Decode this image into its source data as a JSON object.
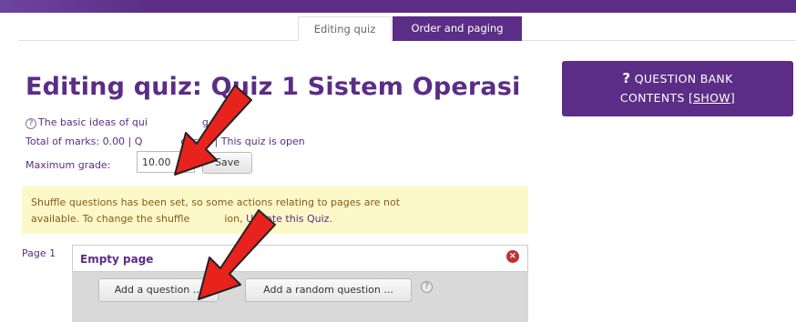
{
  "tabs": {
    "editing": "Editing quiz",
    "order": "Order and paging"
  },
  "header": {
    "title": "Editing quiz: Quiz 1 Sistem Operasi"
  },
  "info": {
    "basic_ideas": "The basic ideas of quiz-making",
    "basic_ideas_visible": "The basic ideas of qui",
    "basic_ideas_tail": "g",
    "totals_a": "Total of marks: 0.00 | Q",
    "totals_b": "ons: 0 | This quiz is open",
    "max_grade_label": "Maximum grade:",
    "max_grade_value": "10.00",
    "save_label": "Save"
  },
  "notice": {
    "text_1": "Shuffle questions has been set, s",
    "text_2": "o some actions relating to pages are not",
    "text_3": "available. To change the shuffle",
    "text_4": "ion, ",
    "link": "Update this Quiz."
  },
  "page": {
    "label": "Page 1",
    "title": "Empty page",
    "add_question": "Add a question ...",
    "add_random": "Add a random question ..."
  },
  "question_bank": {
    "icon": "?",
    "line1": "QUESTION BANK",
    "line2": "CONTENTS ",
    "show_link": "[SHOW]"
  },
  "colors": {
    "brand": "#5b2d86",
    "notice_bg": "#fcf8c8",
    "arrow": "#e8221c"
  }
}
